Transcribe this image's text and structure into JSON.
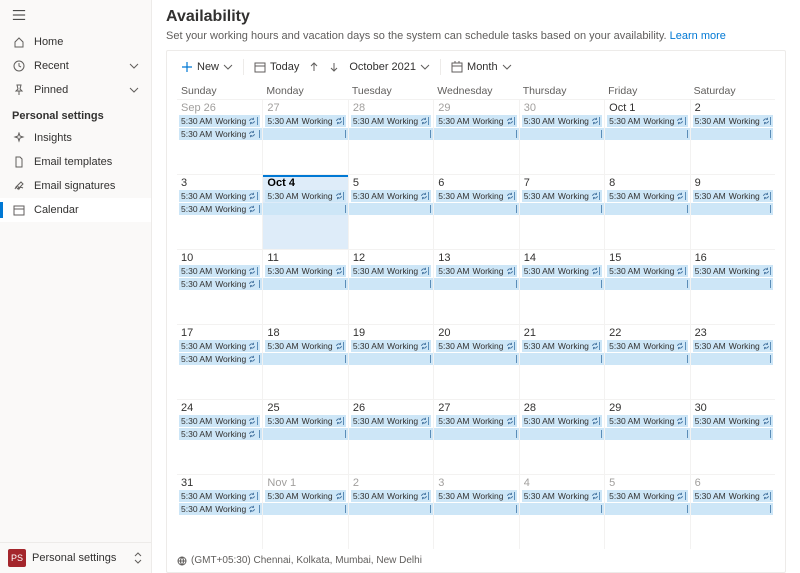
{
  "sidebar": {
    "top": [
      {
        "label": "Home",
        "icon": "home"
      },
      {
        "label": "Recent",
        "icon": "clock",
        "chev": true
      },
      {
        "label": "Pinned",
        "icon": "pin",
        "chev": true
      }
    ],
    "section_title": "Personal settings",
    "items": [
      {
        "label": "Insights",
        "icon": "sparkle"
      },
      {
        "label": "Email templates",
        "icon": "doc"
      },
      {
        "label": "Email signatures",
        "icon": "sig"
      },
      {
        "label": "Calendar",
        "icon": "cal",
        "selected": true
      }
    ],
    "footer_badge": "PS",
    "footer_label": "Personal settings"
  },
  "page": {
    "title": "Availability",
    "desc": "Set your working hours and vacation days so the system can schedule tasks based on your availability.",
    "learn_more": "Learn more"
  },
  "toolbar": {
    "new": "New",
    "today": "Today",
    "month_label": "October 2021",
    "view": "Month"
  },
  "day_headers": [
    "Sunday",
    "Monday",
    "Tuesday",
    "Wednesday",
    "Thursday",
    "Friday",
    "Saturday"
  ],
  "event": {
    "time": "5:30 AM",
    "label": "Working"
  },
  "weeks": [
    [
      {
        "d": "Sep 26",
        "g": true,
        "e": 2
      },
      {
        "d": "27",
        "g": true,
        "e": 2
      },
      {
        "d": "28",
        "g": true,
        "e": 2
      },
      {
        "d": "29",
        "g": true,
        "e": 2
      },
      {
        "d": "30",
        "g": true,
        "e": 2
      },
      {
        "d": "Oct 1",
        "e": 2
      },
      {
        "d": "2",
        "e": 2
      }
    ],
    [
      {
        "d": "3",
        "e": 2
      },
      {
        "d": "Oct 4",
        "today": true,
        "e": 2
      },
      {
        "d": "5",
        "e": 2
      },
      {
        "d": "6",
        "e": 2
      },
      {
        "d": "7",
        "e": 2
      },
      {
        "d": "8",
        "e": 2
      },
      {
        "d": "9",
        "e": 2
      }
    ],
    [
      {
        "d": "10",
        "e": 2
      },
      {
        "d": "11",
        "e": 2
      },
      {
        "d": "12",
        "e": 2
      },
      {
        "d": "13",
        "e": 2
      },
      {
        "d": "14",
        "e": 2
      },
      {
        "d": "15",
        "e": 2
      },
      {
        "d": "16",
        "e": 2
      }
    ],
    [
      {
        "d": "17",
        "e": 2
      },
      {
        "d": "18",
        "e": 2
      },
      {
        "d": "19",
        "e": 2
      },
      {
        "d": "20",
        "e": 2
      },
      {
        "d": "21",
        "e": 2
      },
      {
        "d": "22",
        "e": 2
      },
      {
        "d": "23",
        "e": 2
      }
    ],
    [
      {
        "d": "24",
        "e": 2
      },
      {
        "d": "25",
        "e": 2
      },
      {
        "d": "26",
        "e": 2
      },
      {
        "d": "27",
        "e": 2
      },
      {
        "d": "28",
        "e": 2
      },
      {
        "d": "29",
        "e": 2
      },
      {
        "d": "30",
        "e": 2
      }
    ],
    [
      {
        "d": "31",
        "e": 2
      },
      {
        "d": "Nov 1",
        "g": true,
        "e": 2
      },
      {
        "d": "2",
        "g": true,
        "e": 2
      },
      {
        "d": "3",
        "g": true,
        "e": 2
      },
      {
        "d": "4",
        "g": true,
        "e": 2
      },
      {
        "d": "5",
        "g": true,
        "e": 2
      },
      {
        "d": "6",
        "g": true,
        "e": 2
      }
    ]
  ],
  "timezone": "(GMT+05:30) Chennai, Kolkata, Mumbai, New Delhi"
}
